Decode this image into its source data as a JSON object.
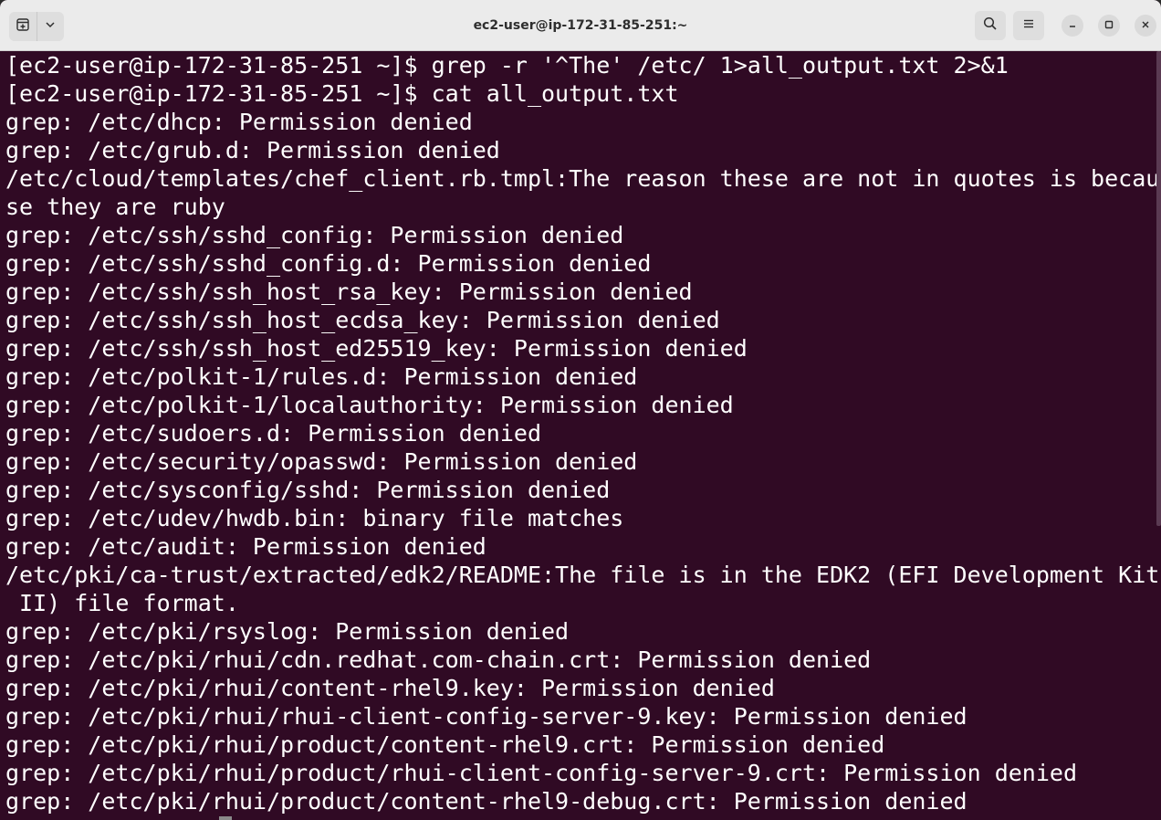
{
  "window": {
    "title": "ec2-user@ip-172-31-85-251:~"
  },
  "icons": {
    "new_tab": "new-tab-icon",
    "tab_menu": "chevron-down-icon",
    "search": "search-icon",
    "menu": "hamburger-menu-icon",
    "minimize": "minimize-icon",
    "maximize": "maximize-icon",
    "close": "close-icon"
  },
  "colors": {
    "terminal_bg": "#300a24",
    "terminal_fg": "#ffffff",
    "titlebar_bg": "#ebebeb"
  },
  "terminal": {
    "lines": [
      "[ec2-user@ip-172-31-85-251 ~]$ grep -r '^The' /etc/ 1>all_output.txt 2>&1",
      "[ec2-user@ip-172-31-85-251 ~]$ cat all_output.txt",
      "grep: /etc/dhcp: Permission denied",
      "grep: /etc/grub.d: Permission denied",
      "/etc/cloud/templates/chef_client.rb.tmpl:The reason these are not in quotes is becau",
      "se they are ruby",
      "grep: /etc/ssh/sshd_config: Permission denied",
      "grep: /etc/ssh/sshd_config.d: Permission denied",
      "grep: /etc/ssh/ssh_host_rsa_key: Permission denied",
      "grep: /etc/ssh/ssh_host_ecdsa_key: Permission denied",
      "grep: /etc/ssh/ssh_host_ed25519_key: Permission denied",
      "grep: /etc/polkit-1/rules.d: Permission denied",
      "grep: /etc/polkit-1/localauthority: Permission denied",
      "grep: /etc/sudoers.d: Permission denied",
      "grep: /etc/security/opasswd: Permission denied",
      "grep: /etc/sysconfig/sshd: Permission denied",
      "grep: /etc/udev/hwdb.bin: binary file matches",
      "grep: /etc/audit: Permission denied",
      "/etc/pki/ca-trust/extracted/edk2/README:The file is in the EDK2 (EFI Development Kit",
      " II) file format.",
      "grep: /etc/pki/rsyslog: Permission denied",
      "grep: /etc/pki/rhui/cdn.redhat.com-chain.crt: Permission denied",
      "grep: /etc/pki/rhui/content-rhel9.key: Permission denied",
      "grep: /etc/pki/rhui/rhui-client-config-server-9.key: Permission denied",
      "grep: /etc/pki/rhui/product/content-rhel9.crt: Permission denied",
      "grep: /etc/pki/rhui/product/rhui-client-config-server-9.crt: Permission denied",
      "grep: /etc/pki/rhui/product/content-rhel9-debug.crt: Permission denied"
    ]
  }
}
